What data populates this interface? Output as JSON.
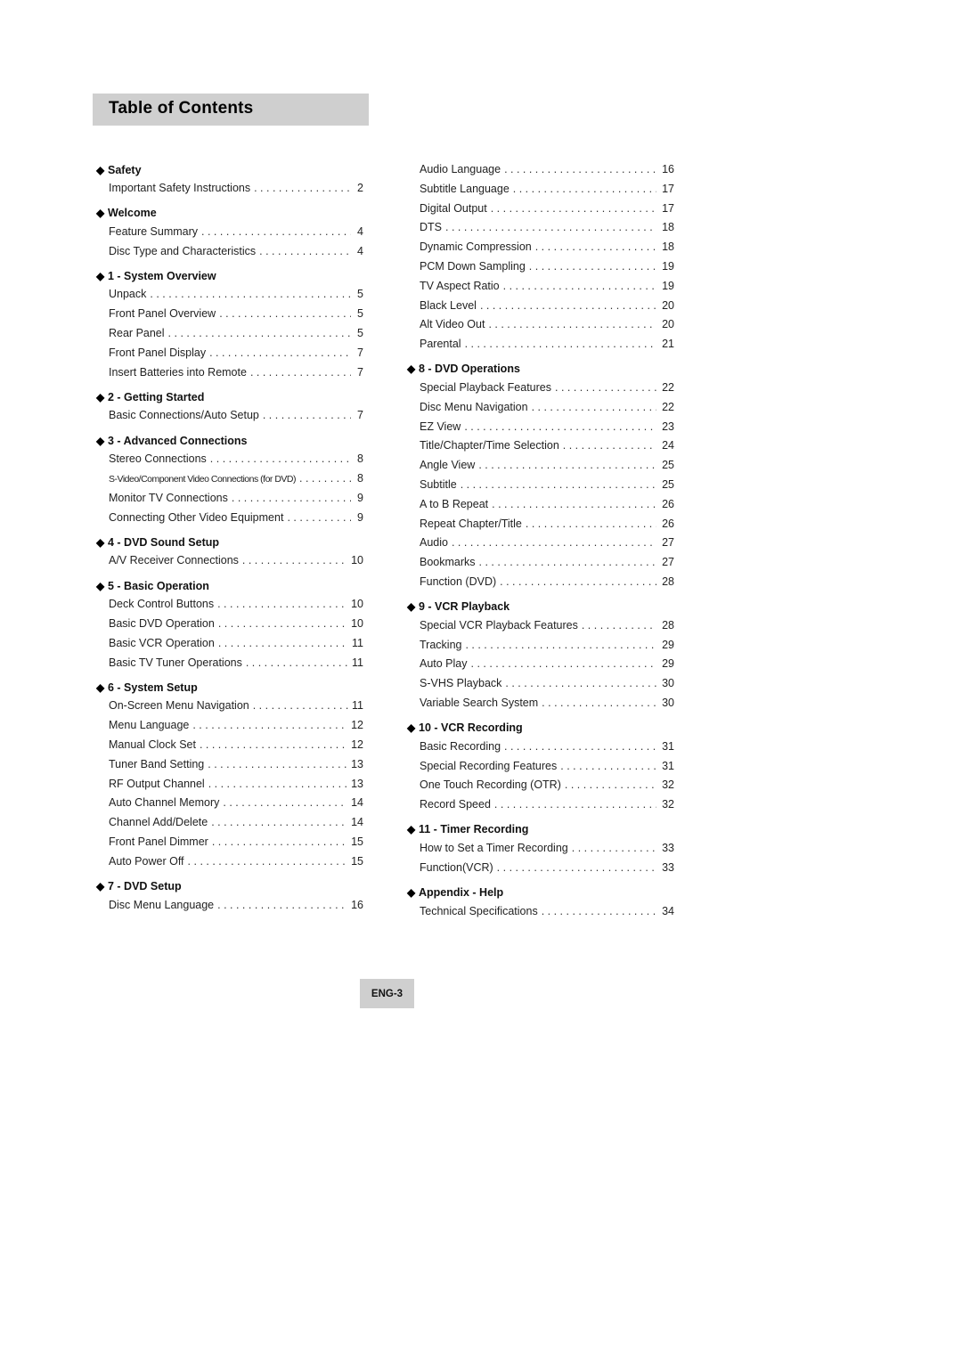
{
  "title": "Table of Contents",
  "footer": {
    "page_label": "ENG-3"
  },
  "left_column": [
    {
      "heading": "Safety",
      "entries": [
        {
          "label": "Important Safety Instructions",
          "page": "2"
        }
      ]
    },
    {
      "heading": "Welcome",
      "entries": [
        {
          "label": "Feature Summary",
          "page": "4"
        },
        {
          "label": "Disc Type and Characteristics",
          "page": "4"
        }
      ]
    },
    {
      "heading": "1 - System Overview",
      "entries": [
        {
          "label": "Unpack",
          "page": "5"
        },
        {
          "label": "Front Panel Overview",
          "page": "5"
        },
        {
          "label": "Rear Panel",
          "page": "5"
        },
        {
          "label": "Front Panel Display",
          "page": "7"
        },
        {
          "label": "Insert Batteries into Remote",
          "page": "7"
        }
      ]
    },
    {
      "heading": "2 - Getting Started",
      "entries": [
        {
          "label": "Basic Connections/Auto Setup",
          "page": "7"
        }
      ]
    },
    {
      "heading": "3 - Advanced Connections",
      "entries": [
        {
          "label": "Stereo Connections",
          "page": "8"
        },
        {
          "label": "S-Video/Component Video Connections (for DVD)",
          "page": "8",
          "condensed": true
        },
        {
          "label": "Monitor TV Connections",
          "page": "9"
        },
        {
          "label": "Connecting Other Video Equipment",
          "page": "9"
        }
      ]
    },
    {
      "heading": "4 - DVD Sound Setup",
      "entries": [
        {
          "label": "A/V Receiver Connections",
          "page": "10"
        }
      ]
    },
    {
      "heading": "5 - Basic Operation",
      "entries": [
        {
          "label": "Deck Control Buttons",
          "page": "10"
        },
        {
          "label": "Basic DVD Operation",
          "page": "10"
        },
        {
          "label": "Basic VCR Operation",
          "page": "11"
        },
        {
          "label": "Basic TV Tuner Operations",
          "page": "11"
        }
      ]
    },
    {
      "heading": "6 - System Setup",
      "entries": [
        {
          "label": "On-Screen Menu Navigation",
          "page": "11"
        },
        {
          "label": "Menu Language",
          "page": "12"
        },
        {
          "label": "Manual Clock Set",
          "page": "12"
        },
        {
          "label": "Tuner Band Setting",
          "page": "13"
        },
        {
          "label": "RF Output Channel",
          "page": "13"
        },
        {
          "label": "Auto Channel Memory",
          "page": "14"
        },
        {
          "label": "Channel Add/Delete",
          "page": "14"
        },
        {
          "label": "Front Panel Dimmer",
          "page": "15"
        },
        {
          "label": "Auto Power Off",
          "page": "15"
        }
      ]
    },
    {
      "heading": "7 - DVD Setup",
      "entries": [
        {
          "label": "Disc Menu Language",
          "page": "16"
        }
      ]
    }
  ],
  "right_column": [
    {
      "heading": null,
      "entries": [
        {
          "label": "Audio Language",
          "page": "16"
        },
        {
          "label": "Subtitle Language",
          "page": "17"
        },
        {
          "label": "Digital Output",
          "page": "17"
        },
        {
          "label": "DTS",
          "page": "18"
        },
        {
          "label": "Dynamic Compression",
          "page": "18"
        },
        {
          "label": "PCM Down Sampling",
          "page": "19"
        },
        {
          "label": "TV Aspect Ratio",
          "page": "19"
        },
        {
          "label": "Black Level",
          "page": "20"
        },
        {
          "label": "Alt Video Out",
          "page": "20"
        },
        {
          "label": "Parental",
          "page": "21"
        }
      ]
    },
    {
      "heading": "8 - DVD Operations",
      "entries": [
        {
          "label": "Special Playback Features",
          "page": "22"
        },
        {
          "label": "Disc Menu Navigation",
          "page": "22"
        },
        {
          "label": "EZ View",
          "page": "23"
        },
        {
          "label": "Title/Chapter/Time Selection",
          "page": "24"
        },
        {
          "label": "Angle View",
          "page": "25"
        },
        {
          "label": "Subtitle",
          "page": "25"
        },
        {
          "label": "A to B Repeat",
          "page": "26"
        },
        {
          "label": "Repeat Chapter/Title",
          "page": "26"
        },
        {
          "label": "Audio",
          "page": "27"
        },
        {
          "label": "Bookmarks",
          "page": "27"
        },
        {
          "label": "Function (DVD)",
          "page": "28"
        }
      ]
    },
    {
      "heading": "9 - VCR Playback",
      "entries": [
        {
          "label": "Special VCR Playback Features",
          "page": "28"
        },
        {
          "label": "Tracking",
          "page": "29"
        },
        {
          "label": "Auto Play",
          "page": "29"
        },
        {
          "label": "S-VHS Playback",
          "page": "30"
        },
        {
          "label": "Variable Search System",
          "page": "30"
        }
      ]
    },
    {
      "heading": "10 - VCR Recording",
      "entries": [
        {
          "label": "Basic Recording",
          "page": "31"
        },
        {
          "label": "Special Recording Features",
          "page": "31"
        },
        {
          "label": "One Touch Recording (OTR)",
          "page": "32"
        },
        {
          "label": "Record Speed",
          "page": "32"
        }
      ]
    },
    {
      "heading": "11 - Timer Recording",
      "entries": [
        {
          "label": "How to Set a Timer Recording",
          "page": "33"
        },
        {
          "label": "Function(VCR)",
          "page": "33"
        }
      ]
    },
    {
      "heading": "Appendix - Help",
      "entries": [
        {
          "label": "Technical Specifications",
          "page": "34"
        }
      ]
    }
  ]
}
